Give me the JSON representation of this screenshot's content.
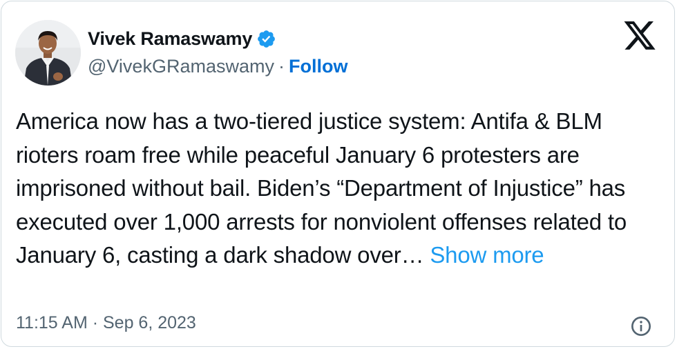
{
  "author": {
    "display_name": "Vivek Ramaswamy",
    "handle": "@VivekGRamaswamy",
    "separator": "·",
    "follow_label": "Follow",
    "verified": true
  },
  "tweet": {
    "text": "America now has a two-tiered justice system: Antifa & BLM rioters roam free while peaceful January 6 protesters are imprisoned without bail. Biden’s “Department of Injustice” has executed over 1,000 arrests for nonviolent offenses related to January 6, casting a dark shadow over…",
    "show_more_label": "Show more"
  },
  "meta": {
    "timestamp": "11:15 AM · Sep 6, 2023"
  },
  "colors": {
    "link": "#1d9bf0",
    "follow": "#006fd6",
    "secondary_text": "#536471",
    "primary_text": "#0f1419",
    "border": "#cfd9de"
  },
  "icons": {
    "verified": "verified-badge-icon",
    "brand": "x-logo-icon",
    "info": "info-icon"
  }
}
